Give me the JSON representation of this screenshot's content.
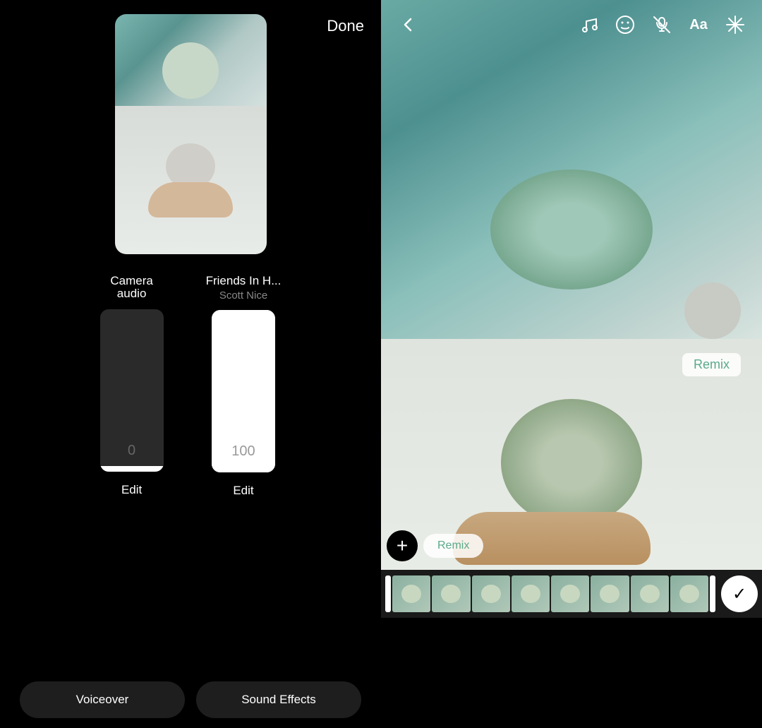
{
  "left": {
    "done_label": "Done",
    "camera_audio": {
      "title_line1": "Camera",
      "title_line2": "audio",
      "volume": "0",
      "edit_label": "Edit"
    },
    "music_track": {
      "title": "Friends In H...",
      "artist": "Scott Nice",
      "volume": "100",
      "edit_label": "Edit"
    },
    "voiceover_label": "Voiceover",
    "sound_effects_label": "Sound Effects"
  },
  "right": {
    "back_icon": "‹",
    "music_icon": "♫",
    "face_icon": "☺",
    "voice_icon": "🎤",
    "text_icon": "Aa",
    "sparkle_icon": "✦",
    "remix_label": "Remix",
    "plus_icon": "+",
    "check_icon": "✓"
  }
}
